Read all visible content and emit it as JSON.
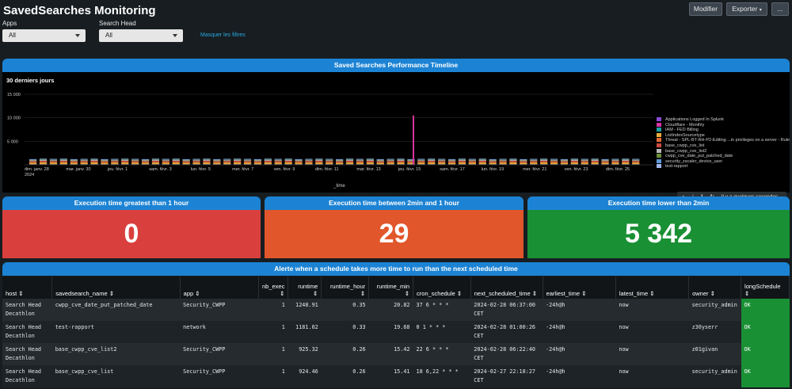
{
  "header": {
    "title": "SavedSearches Monitoring",
    "edit_label": "Modifier",
    "export_label": "Exporter",
    "more_label": "..."
  },
  "filters": {
    "apps_label": "Apps",
    "apps_value": "All",
    "search_head_label": "Search Head",
    "search_head_value": "All",
    "hide_filters_label": "Masquer les filtres"
  },
  "timeline_panel": {
    "title": "Saved Searches Performance Timeline",
    "subtitle": "30 derniers jours",
    "toolbar_status": "Il y a quelques secondes"
  },
  "chart_data": {
    "type": "bar",
    "stacked": true,
    "xlabel": "_time",
    "ylabel": "",
    "ylim": [
      0,
      15000
    ],
    "y_ticks": [
      "15 000",
      "10 000",
      "5 000"
    ],
    "y_tick_values": [
      15000,
      10000,
      5000
    ],
    "x_tick_labels": [
      "dim. janv. 28",
      "mar. janv. 30",
      "jeu. févr. 1",
      "sam. févr. 3",
      "lun. févr. 5",
      "mer. févr. 7",
      "ven. févr. 9",
      "dim. févr. 11",
      "mar. févr. 13",
      "jeu. févr. 15",
      "sam. févr. 17",
      "lun. févr. 19",
      "mer. févr. 21",
      "ven. févr. 23",
      "dim. févr. 25"
    ],
    "x_year_label": "2024",
    "grid": true,
    "legend_position": "right",
    "series": [
      {
        "name": "Applications Logged In Splunk",
        "color": "#8a4bd6"
      },
      {
        "name": "Cloudflare - Monthly",
        "color": "#d6339e"
      },
      {
        "name": "IAM - FED Billing",
        "color": "#1a9fa3"
      },
      {
        "name": "ListIndexSourcetype",
        "color": "#e8ab3a"
      },
      {
        "name": "Threat - SPL-BT-RH-P2-Editing ...in privileges on a server - Rule",
        "color": "#e06a3a"
      },
      {
        "name": "base_cwpp_cve_list",
        "color": "#c94a42"
      },
      {
        "name": "base_cwpp_cve_list2",
        "color": "#b8b8b8"
      },
      {
        "name": "cwpp_cve_date_put_patched_date",
        "color": "#6b8f3a"
      },
      {
        "name": "security_zscaler_device_user",
        "color": "#5e9bd8"
      },
      {
        "name": "test-rapport",
        "color": "#9fb5ea"
      }
    ],
    "daily_total_values": [
      1200,
      1300,
      1250,
      1300,
      1200,
      1250,
      1300,
      1200,
      1250,
      1300,
      1250,
      1200,
      1300,
      1250,
      1300,
      1200,
      1250,
      1300,
      1200,
      1250,
      1300,
      1250,
      1200,
      1300,
      1250,
      1300,
      1200,
      1250,
      1300,
      1250,
      1200,
      1300,
      1250,
      1300,
      1200,
      1250,
      1300,
      1200,
      1250,
      1300,
      1250,
      1200,
      1300,
      1250,
      1300,
      1200,
      1250,
      1300,
      1200,
      1250,
      1300,
      1250,
      1200,
      1300,
      1250,
      1300,
      1200,
      1250,
      1300,
      1250
    ],
    "spike": {
      "x_label": "jeu. févr. 15",
      "series": "Cloudflare - Monthly",
      "value": 10500
    }
  },
  "stats": [
    {
      "title": "Execution time greatest than 1 hour",
      "value": "0",
      "color": "#d93f3c"
    },
    {
      "title": "Execution time between 2min and 1 hour",
      "value": "29",
      "color": "#e1562a"
    },
    {
      "title": "Execution time lower than 2min",
      "value": "5 342",
      "color": "#1a9035"
    }
  ],
  "table_panel": {
    "title": "Alerte when a schedule takes more time to run than the next scheduled time",
    "columns": [
      "host",
      "savedsearch_name",
      "app",
      "nb_exec",
      "runtime",
      "runtime_hour",
      "runtime_min",
      "cron_schedule",
      "next_scheduled_time",
      "earliest_time",
      "latest_time",
      "owner",
      "longSchedule"
    ],
    "rows": [
      {
        "host": "Search Head Decathlon",
        "savedsearch_name": "cwpp_cve_date_put_patched_date",
        "app": "Security_CWPP",
        "nb_exec": "1",
        "runtime": "1248.91",
        "runtime_hour": "0.35",
        "runtime_min": "20.82",
        "cron_schedule": "37 6 * * *",
        "next_scheduled_time": "2024-02-28 06:37:00 CET",
        "earliest_time": "-24h@h",
        "latest_time": "now",
        "owner": "security_admin",
        "longSchedule": "OK"
      },
      {
        "host": "Search Head Decathlon",
        "savedsearch_name": "test-rapport",
        "app": "network",
        "nb_exec": "1",
        "runtime": "1181.02",
        "runtime_hour": "0.33",
        "runtime_min": "19.68",
        "cron_schedule": "0 1 * * *",
        "next_scheduled_time": "2024-02-28 01:00:26 CET",
        "earliest_time": "-24h@h",
        "latest_time": "now",
        "owner": "z30yserr",
        "longSchedule": "OK"
      },
      {
        "host": "Search Head Decathlon",
        "savedsearch_name": "base_cwpp_cve_list2",
        "app": "Security_CWPP",
        "nb_exec": "1",
        "runtime": "925.32",
        "runtime_hour": "0.26",
        "runtime_min": "15.42",
        "cron_schedule": "22 6 * * *",
        "next_scheduled_time": "2024-02-28 06:22:40 CET",
        "earliest_time": "-24h@h",
        "latest_time": "now",
        "owner": "z01givan",
        "longSchedule": "OK"
      },
      {
        "host": "Search Head Decathlon",
        "savedsearch_name": "base_cwpp_cve_list",
        "app": "Security_CWPP",
        "nb_exec": "1",
        "runtime": "924.46",
        "runtime_hour": "0.26",
        "runtime_min": "15.41",
        "cron_schedule": "18 6,22 * * *",
        "next_scheduled_time": "2024-02-27 22:18:27 CET",
        "earliest_time": "-24h@h",
        "latest_time": "now",
        "owner": "security_admin",
        "longSchedule": "OK"
      }
    ]
  }
}
